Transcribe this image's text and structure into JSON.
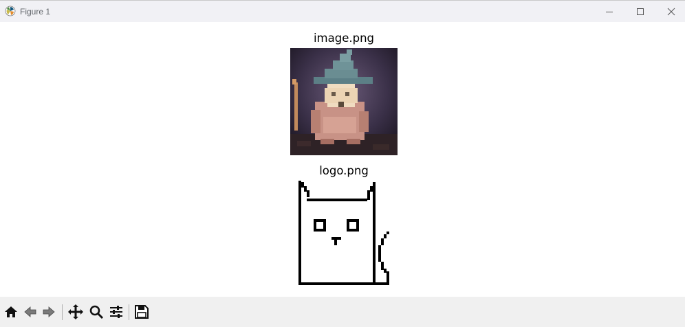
{
  "window": {
    "title": "Figure 1",
    "controls": [
      "minimize-icon",
      "maximize-icon",
      "close-icon"
    ]
  },
  "figure": {
    "images": [
      {
        "caption": "image.png",
        "content": "pixelated photo of a figurine wearing a witch hat holding a staff"
      },
      {
        "caption": "logo.png",
        "content": "pixel-art line drawing of a cat"
      }
    ]
  },
  "toolbar": {
    "buttons": [
      "home-icon",
      "back-icon",
      "forward-icon",
      "pan-icon",
      "zoom-icon",
      "configure-subplots-icon",
      "save-icon"
    ]
  },
  "colors": {
    "titlebar": "#f1f1f5",
    "toolbar": "#f0f0f0",
    "canvas": "#ffffff"
  }
}
